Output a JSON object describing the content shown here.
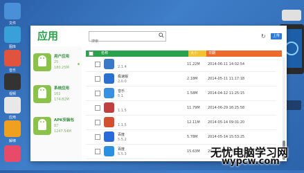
{
  "desktop": {
    "left_items": [
      {
        "label": "文件",
        "color": "#4a90d9"
      },
      {
        "label": "图库",
        "color": "#3aa0d8"
      },
      {
        "label": "音乐",
        "color": "#e0533f"
      },
      {
        "label": "视频",
        "color": "#333333"
      },
      {
        "label": "应用",
        "color": "#e8e8e8"
      },
      {
        "label": "解绑",
        "color": "#f0a020"
      },
      {
        "label": "",
        "color": "#e84a6a"
      }
    ]
  },
  "window": {
    "title": "应用",
    "search": {
      "placeholder": "搜索",
      "icon": "search-icon"
    },
    "upload_label": "上传"
  },
  "sidebar": {
    "categories": [
      {
        "name": "用户应用",
        "count": "25",
        "size": "180.25M",
        "color": "#8bc34a"
      },
      {
        "name": "系统应用",
        "count": "162",
        "size": "174.82M",
        "color": "#8bc34a"
      },
      {
        "name": "APK安装包",
        "count": "87",
        "size": "1247.54M",
        "color": "#8bc34a"
      }
    ]
  },
  "table": {
    "headers": {
      "name": "名称",
      "size": "大小",
      "date": "日期"
    },
    "rows": [
      {
        "name": "",
        "version": "2.1.4",
        "size": "11.22M",
        "date": "2014-06-11 14:02:54",
        "color": "#3a78c8"
      },
      {
        "name": "极速版",
        "version": "2.0.0",
        "size": "2.18M",
        "date": "2014-05-11 11:17:18",
        "color": "#2a70d0"
      },
      {
        "name": "音乐",
        "version": "5.1",
        "size": "1.58M",
        "date": "2014-04-12 11:25:15",
        "color": "#3a90e0"
      },
      {
        "name": "",
        "version": "1.1.5",
        "size": "11.79M",
        "date": "2014-06-29 16:25:58",
        "color": "#c04040"
      },
      {
        "name": "",
        "version": "1.1.5",
        "size": "12.11M",
        "date": "2014-05-14 09:01:20",
        "color": "#d05030"
      },
      {
        "name": "百度",
        "version": "5.5.2",
        "size": "5.78M",
        "date": "2014-05-14 15:53:25",
        "color": "#2a6ad8"
      },
      {
        "name": "百度",
        "version": "5.5.3",
        "size": "15.63M",
        "date": "2014-05-16 13:51:43",
        "color": "#2a90e0"
      }
    ]
  },
  "watermark": {
    "line1": "无忧电脑学习网",
    "line2": "wypcw.com"
  }
}
